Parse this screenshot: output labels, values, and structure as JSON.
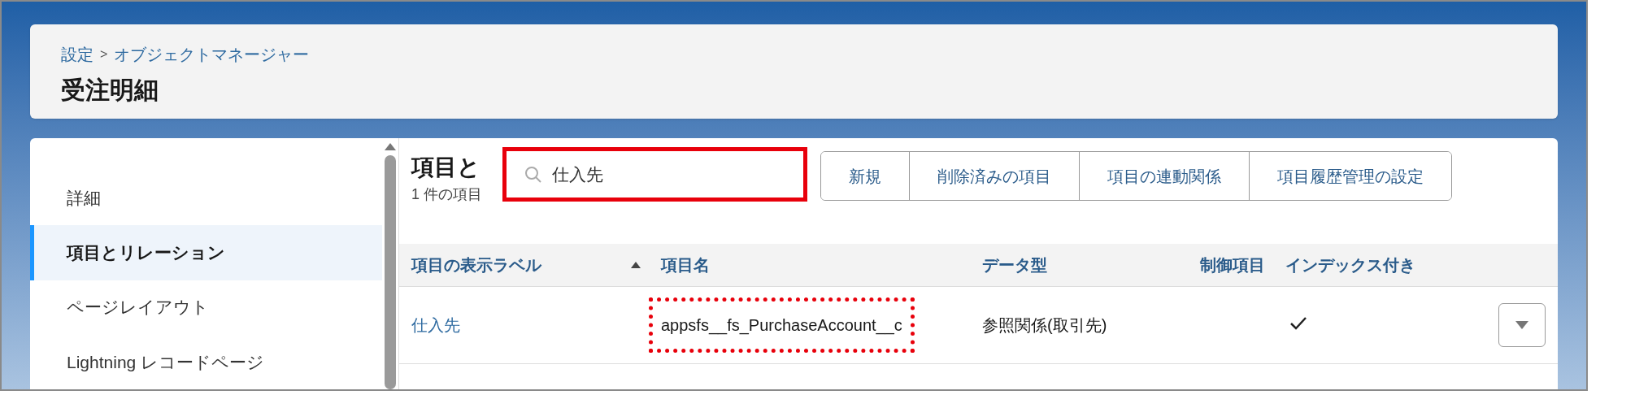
{
  "breadcrumb": {
    "parent": "設定",
    "separator": ">",
    "current": "オブジェクトマネージャー"
  },
  "title": "受注明細",
  "sidebar": {
    "items": [
      {
        "label": "詳細",
        "selected": false
      },
      {
        "label": "項目とリレーション",
        "selected": true
      },
      {
        "label": "ページレイアウト",
        "selected": false
      },
      {
        "label": "Lightning レコードページ",
        "selected": false
      }
    ]
  },
  "section": {
    "heading": "項目と",
    "subtitle": "1 件の項目"
  },
  "search": {
    "value": "仕入先",
    "highlighted": true
  },
  "buttons": [
    "新規",
    "削除済みの項目",
    "項目の連動関係",
    "項目履歴管理の設定"
  ],
  "table": {
    "columns": [
      {
        "label": "項目の表示ラベル",
        "sorted": true
      },
      {
        "label": "項目名",
        "sorted": false
      },
      {
        "label": "データ型",
        "sorted": false
      },
      {
        "label": "制御項目",
        "sorted": false
      },
      {
        "label": "インデックス付き",
        "sorted": false
      }
    ],
    "rows": [
      {
        "label": "仕入先",
        "api_name": "appsfs__fs_PurchaseAccount__c",
        "api_name_highlighted": true,
        "data_type": "参照関係(取引先)",
        "controlling": "",
        "indexed": true
      }
    ]
  }
}
